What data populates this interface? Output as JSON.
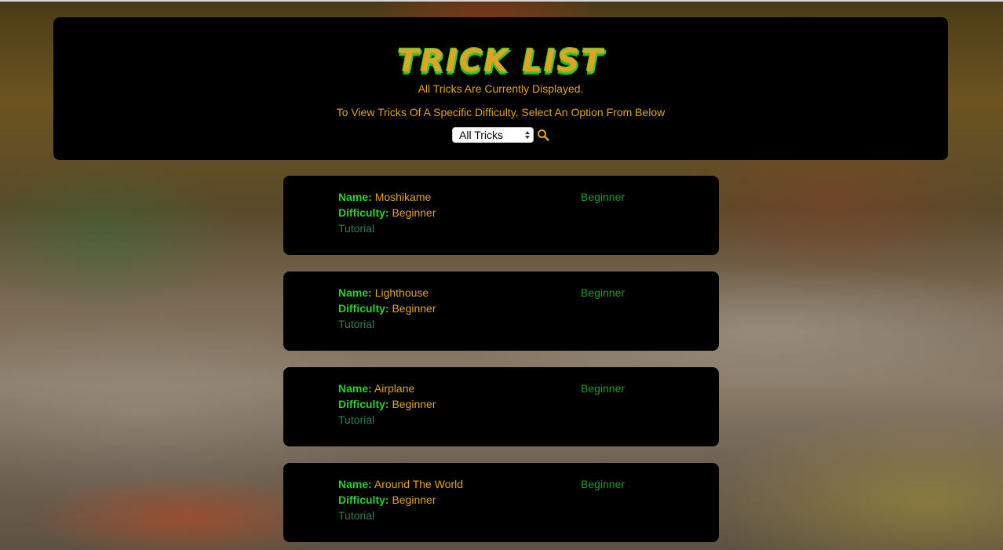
{
  "header": {
    "title": "TRICK LIST",
    "subtitle": "All Tricks Are Currently Displayed.",
    "instruction": "To View Tricks Of A Specific Difficulty, Select An Option From Below",
    "filter": {
      "selected": "All Tricks"
    },
    "search_icon": "search-icon"
  },
  "labels": {
    "name": "Name:",
    "difficulty": "Difficulty:"
  },
  "tricks": [
    {
      "name": "Moshikame",
      "difficulty": "Beginner",
      "tutorial": "Tutorial",
      "level": "Beginner"
    },
    {
      "name": "Lighthouse",
      "difficulty": "Beginner",
      "tutorial": "Tutorial",
      "level": "Beginner"
    },
    {
      "name": "Airplane",
      "difficulty": "Beginner",
      "tutorial": "Tutorial",
      "level": "Beginner"
    },
    {
      "name": "Around The World",
      "difficulty": "Beginner",
      "tutorial": "Tutorial",
      "level": "Beginner"
    }
  ],
  "colors": {
    "accent_orange": "#e0a323",
    "accent_green": "#29d12f",
    "tutorial_link": "#2e7f52",
    "level_green": "#1e9a25"
  }
}
